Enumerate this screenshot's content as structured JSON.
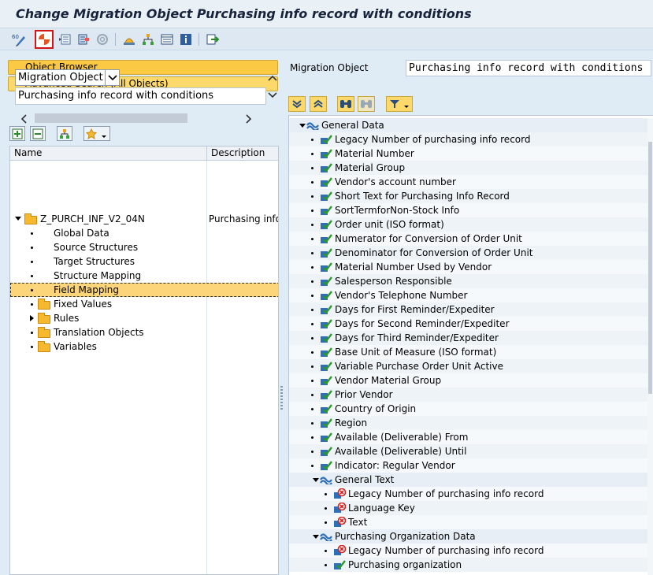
{
  "window": {
    "title": "Change Migration Object Purchasing info record with conditions"
  },
  "toolbar": {
    "icons": [
      "display-change-icon",
      "generate-icon",
      "structure-icon",
      "mapping-icon",
      "rule-icon",
      "object-hierarchy-icon",
      "tree-icon",
      "list-icon",
      "info-icon",
      "export-icon"
    ]
  },
  "left": {
    "object_browser": "Object Browser",
    "advanced_search": "Advanced Search (All Objects)",
    "search_type": "Migration Object",
    "search_value": "Purchasing info record with conditions",
    "columns": {
      "name": "Name",
      "description": "Description"
    },
    "tree": {
      "root": {
        "name": "Z_PURCH_INF_V2_04N",
        "description": "Purchasing info r"
      },
      "items": [
        {
          "name": "Global Data"
        },
        {
          "name": "Source Structures"
        },
        {
          "name": "Target Structures"
        },
        {
          "name": "Structure Mapping"
        },
        {
          "name": "Field Mapping"
        },
        {
          "name": "Fixed Values"
        },
        {
          "name": "Rules"
        },
        {
          "name": "Translation Objects"
        },
        {
          "name": "Variables"
        }
      ]
    }
  },
  "right": {
    "label": "Migration Object",
    "value": "Purchasing info record with conditions",
    "nodes": [
      {
        "label": "General Data",
        "type": "folder"
      },
      {
        "label": "Legacy Number of purchasing info record",
        "type": "field"
      },
      {
        "label": "Material Number",
        "type": "field"
      },
      {
        "label": "Material Group",
        "type": "field"
      },
      {
        "label": "Vendor's account number",
        "type": "field"
      },
      {
        "label": "Short Text for Purchasing Info Record",
        "type": "field"
      },
      {
        "label": "SortTermforNon-Stock Info",
        "type": "field"
      },
      {
        "label": "Order unit (ISO format)",
        "type": "field"
      },
      {
        "label": "Numerator for Conversion of Order Unit",
        "type": "field"
      },
      {
        "label": "Denominator for Conversion of Order Unit",
        "type": "field"
      },
      {
        "label": "Material Number Used by Vendor",
        "type": "field"
      },
      {
        "label": "Salesperson Responsible",
        "type": "field"
      },
      {
        "label": "Vendor's Telephone Number",
        "type": "field"
      },
      {
        "label": "Days for First Reminder/Expediter",
        "type": "field"
      },
      {
        "label": "Days for Second Reminder/Expediter",
        "type": "field"
      },
      {
        "label": "Days for Third Reminder/Expediter",
        "type": "field"
      },
      {
        "label": "Base Unit of Measure (ISO format)",
        "type": "field"
      },
      {
        "label": "Variable Purchase Order Unit Active",
        "type": "field"
      },
      {
        "label": "Vendor Material Group",
        "type": "field"
      },
      {
        "label": "Prior Vendor",
        "type": "field"
      },
      {
        "label": "Country of Origin",
        "type": "field"
      },
      {
        "label": "Region",
        "type": "field"
      },
      {
        "label": "Available (Deliverable) From",
        "type": "field"
      },
      {
        "label": "Available (Deliverable) Until",
        "type": "field"
      },
      {
        "label": "Indicator: Regular Vendor",
        "type": "field"
      },
      {
        "label": "General Text",
        "type": "subfolder"
      },
      {
        "label": "Legacy Number of purchasing info record",
        "type": "field-x"
      },
      {
        "label": "Language Key",
        "type": "field-x"
      },
      {
        "label": "Text",
        "type": "field-x"
      },
      {
        "label": "Purchasing Organization Data",
        "type": "subfolder"
      },
      {
        "label": "Legacy Number of purchasing info record",
        "type": "field-x"
      },
      {
        "label": "Purchasing organization",
        "type": "field"
      }
    ]
  },
  "colors": {
    "accent_yellow": "#fdd86a",
    "highlight_red": "#d41515",
    "background": "#dfebf5"
  }
}
